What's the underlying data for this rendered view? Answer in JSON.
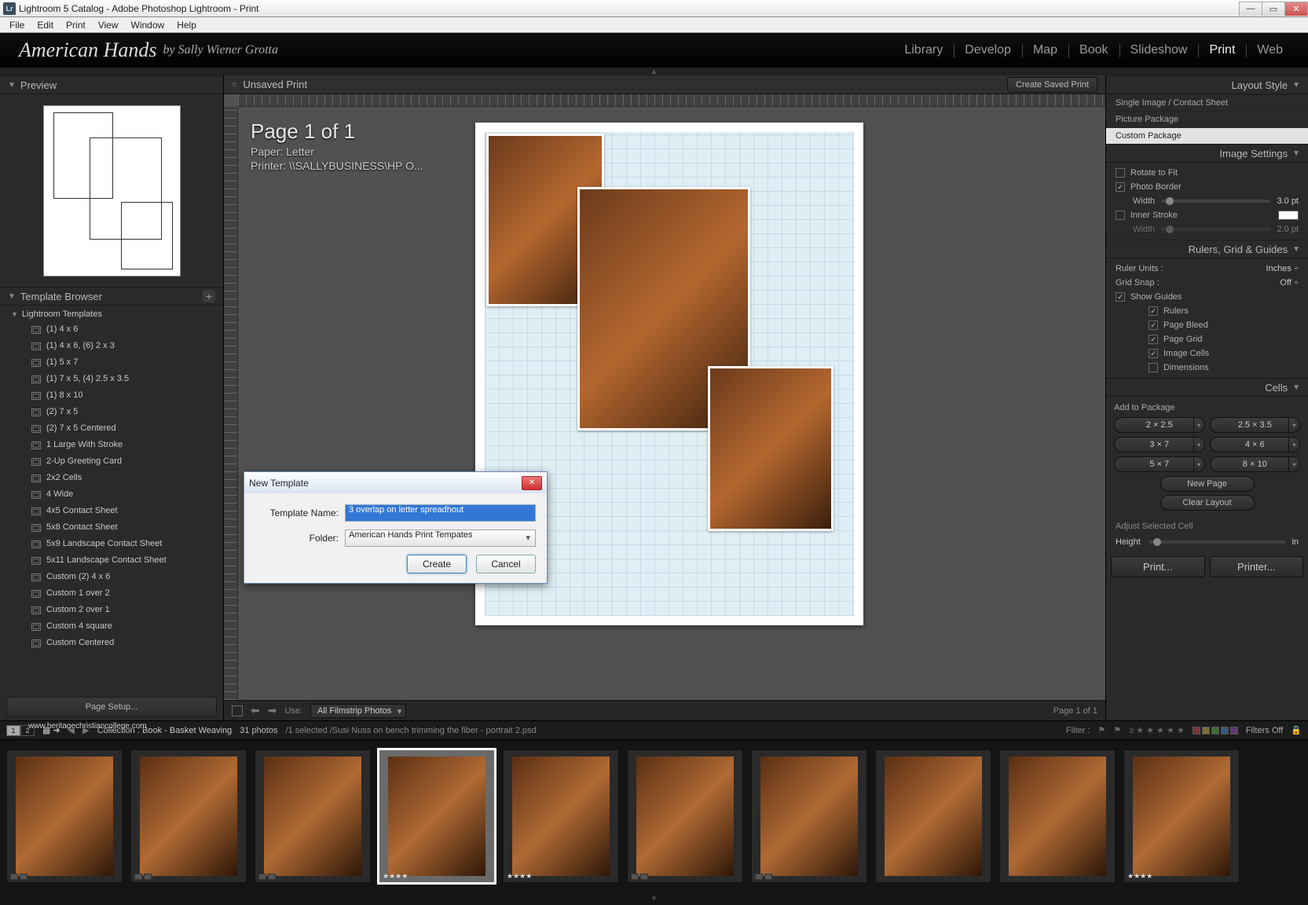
{
  "window": {
    "title": "Lightroom 5 Catalog - Adobe Photoshop Lightroom - Print",
    "icon_label": "Lr"
  },
  "menubar": [
    "File",
    "Edit",
    "Print",
    "View",
    "Window",
    "Help"
  ],
  "identity": {
    "main": "American Hands",
    "sub": "by Sally Wiener Grotta"
  },
  "modules": [
    "Library",
    "Develop",
    "Map",
    "Book",
    "Slideshow",
    "Print",
    "Web"
  ],
  "active_module": "Print",
  "left": {
    "preview_label": "Preview",
    "template_browser_label": "Template Browser",
    "group": "Lightroom Templates",
    "templates": [
      "(1) 4 x 6",
      "(1) 4 x 6, (6) 2 x 3",
      "(1) 5 x 7",
      "(1) 7 x 5, (4) 2.5 x 3.5",
      "(1) 8 x 10",
      "(2) 7 x 5",
      "(2) 7 x 5 Centered",
      "1 Large With Stroke",
      "2-Up Greeting Card",
      "2x2 Cells",
      "4 Wide",
      "4x5 Contact Sheet",
      "5x8 Contact Sheet",
      "5x9 Landscape Contact Sheet",
      "5x11 Landscape Contact Sheet",
      "Custom (2) 4 x 6",
      "Custom 1 over 2",
      "Custom 2 over 1",
      "Custom 4 square",
      "Custom Centered"
    ],
    "page_setup": "Page Setup..."
  },
  "center": {
    "unsaved": "Unsaved Print",
    "create_saved": "Create Saved Print",
    "page_title": "Page 1 of 1",
    "paper_line": "Paper:  Letter",
    "printer_line": "Printer:  \\\\SALLYBUSINESS\\HP O...",
    "use_label": "Use:",
    "use_value": "All Filmstrip Photos",
    "page_of": "Page 1 of 1"
  },
  "right": {
    "layout_style": "Layout Style",
    "layout_items": [
      "Single Image / Contact Sheet",
      "Picture Package",
      "Custom Package"
    ],
    "layout_active": "Custom Package",
    "image_settings": "Image Settings",
    "rotate_to_fit": "Rotate to Fit",
    "photo_border": "Photo Border",
    "width_label": "Width",
    "border_value": "3.0",
    "border_unit": "pt",
    "inner_stroke": "Inner Stroke",
    "inner_value": "2.0",
    "inner_unit": "pt",
    "rulers_section": "Rulers, Grid & Guides",
    "ruler_units_label": "Ruler Units :",
    "ruler_units_value": "Inches",
    "grid_snap_label": "Grid Snap :",
    "grid_snap_value": "Off",
    "show_guides": "Show Guides",
    "guide_items": [
      "Rulers",
      "Page Bleed",
      "Page Grid",
      "Image Cells",
      "Dimensions"
    ],
    "cells_section": "Cells",
    "add_to_package": "Add to Package",
    "cell_row1": [
      "2 × 2.5",
      "2.5 × 3.5"
    ],
    "cell_row2": [
      "3 × 7",
      "4 × 6"
    ],
    "cell_row3": [
      "5 × 7",
      "8 × 10"
    ],
    "new_page": "New Page",
    "clear_layout": "Clear Layout",
    "adjust_selected": "Adjust Selected Cell",
    "height_label": "Height",
    "print_btn": "Print...",
    "printer_btn": "Printer..."
  },
  "collection_bar": {
    "pages": [
      "1",
      "2"
    ],
    "collection_prefix": "Collection : ",
    "collection": "Book - Basket Weaving",
    "photo_count": "31 photos",
    "selection": "/1 selected /Susi Nuss on bench trimming the fiber - portrait 2.psd",
    "filter_label": "Filter :",
    "stars": "≥ ★ ★ ★ ★ ★",
    "filters_off": "Filters Off"
  },
  "dialog": {
    "title": "New Template",
    "name_label": "Template Name:",
    "name_value": "3 overlap on letter spreadhout",
    "folder_label": "Folder:",
    "folder_value": "American Hands Print Tempates",
    "create": "Create",
    "cancel": "Cancel"
  },
  "watermark": "www.heritagechristiancollege.com"
}
